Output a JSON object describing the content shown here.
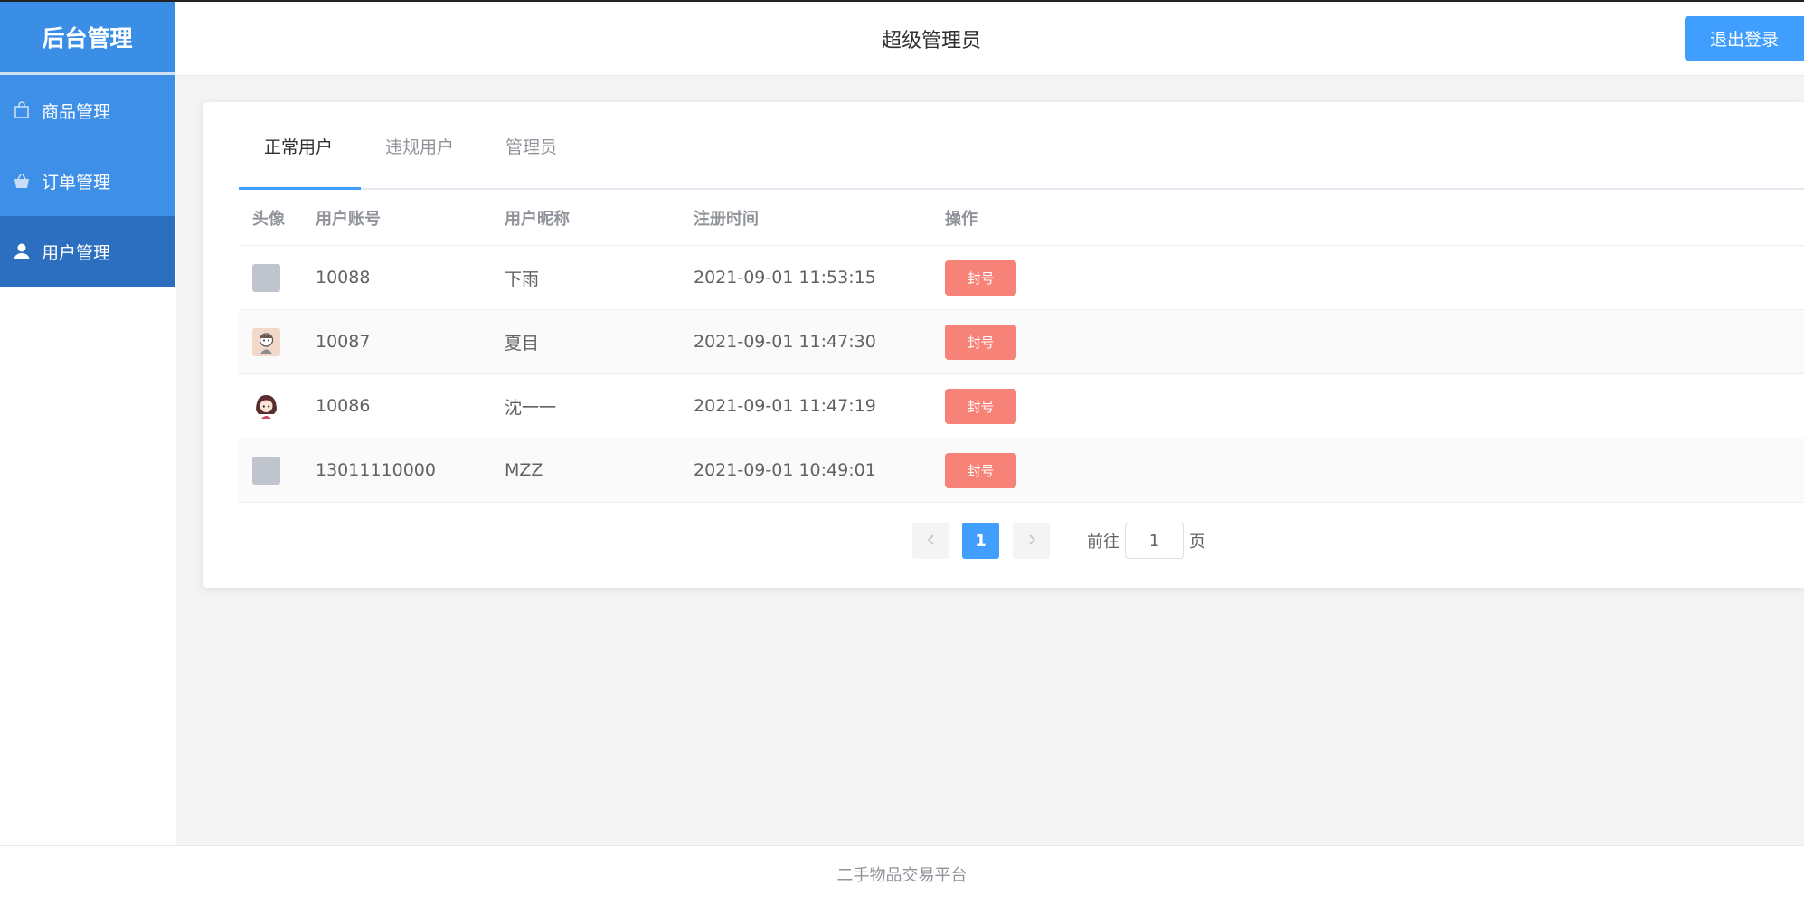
{
  "brand": {
    "title": "后台管理"
  },
  "sidebar": {
    "items": [
      {
        "label": "商品管理",
        "icon": "shopping-bag-icon",
        "active": false
      },
      {
        "label": "订单管理",
        "icon": "basket-icon",
        "active": false
      },
      {
        "label": "用户管理",
        "icon": "user-icon",
        "active": true
      }
    ]
  },
  "header": {
    "title": "超级管理员",
    "logout_label": "退出登录"
  },
  "tabs": [
    {
      "label": "正常用户",
      "active": true
    },
    {
      "label": "违规用户",
      "active": false
    },
    {
      "label": "管理员",
      "active": false
    }
  ],
  "table": {
    "columns": [
      "头像",
      "用户账号",
      "用户昵称",
      "注册时间",
      "操作"
    ],
    "rows": [
      {
        "avatar": "default-avatar",
        "account": "10088",
        "nickname": "下雨",
        "registered": "2021-09-01 11:53:15",
        "action": "封号"
      },
      {
        "avatar": "cartoon-avatar",
        "account": "10087",
        "nickname": "夏目",
        "registered": "2021-09-01 11:47:30",
        "action": "封号"
      },
      {
        "avatar": "girl-avatar",
        "account": "10086",
        "nickname": "沈一一",
        "registered": "2021-09-01 11:47:19",
        "action": "封号"
      },
      {
        "avatar": "default-avatar",
        "account": "13011110000",
        "nickname": "MZZ",
        "registered": "2021-09-01 10:49:01",
        "action": "封号"
      }
    ]
  },
  "pagination": {
    "prev_icon": "chevron-left-icon",
    "current_page": "1",
    "next_icon": "chevron-right-icon",
    "goto_prefix": "前往",
    "goto_value": "1",
    "goto_suffix": "页"
  },
  "footer": {
    "text": "二手物品交易平台"
  },
  "colors": {
    "primary": "#409eff",
    "sidebar": "#3d8fe8",
    "sidebar_active": "#2c6fc0",
    "danger": "#f78277"
  }
}
